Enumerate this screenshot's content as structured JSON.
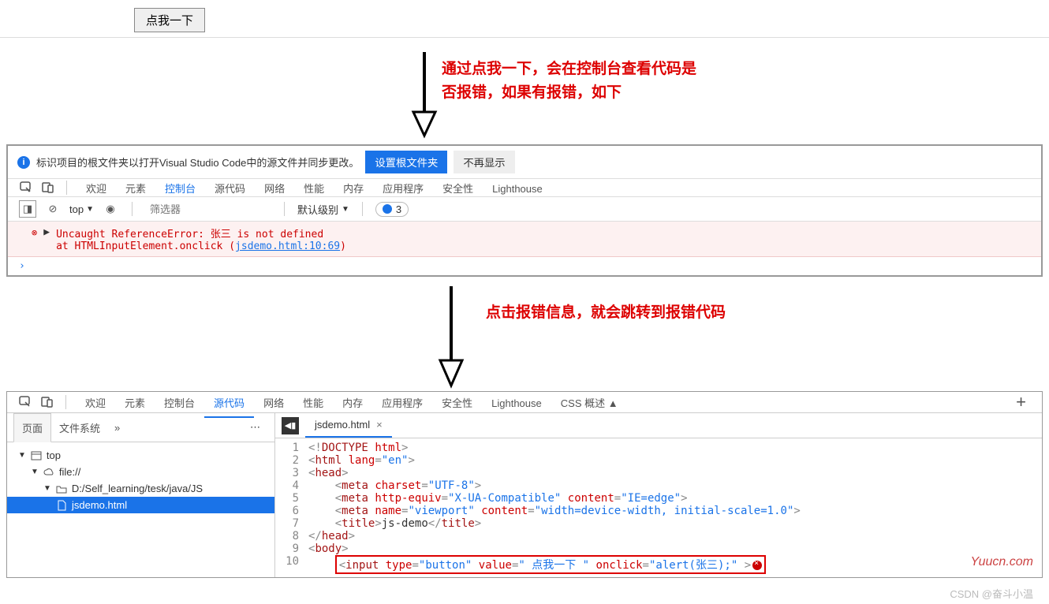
{
  "page": {
    "button_label": "点我一下"
  },
  "annotations": {
    "text1_line1": "通过点我一下，会在控制台查看代码是",
    "text1_line2": "否报错，如果有报错，如下",
    "text2": "点击报错信息，就会跳转到报错代码"
  },
  "notice": {
    "text": "标识项目的根文件夹以打开Visual Studio Code中的源文件并同步更改。",
    "btn_primary": "设置根文件夹",
    "btn_dismiss": "不再显示"
  },
  "tabs1": [
    "欢迎",
    "元素",
    "控制台",
    "源代码",
    "网络",
    "性能",
    "内存",
    "应用程序",
    "安全性",
    "Lighthouse"
  ],
  "tabs1_active": 2,
  "console_toolbar": {
    "context": "top",
    "filter_placeholder": "筛选器",
    "level": "默认级别",
    "issues": "3"
  },
  "console_error": {
    "line1_a": "Uncaught ReferenceError: ",
    "line1_b": "张三",
    "line1_c": " is not defined",
    "line2_a": "    at HTMLInputElement.onclick (",
    "line2_link": "jsdemo.html:10:69",
    "line2_b": ")"
  },
  "tabs2": [
    "欢迎",
    "元素",
    "控制台",
    "源代码",
    "网络",
    "性能",
    "内存",
    "应用程序",
    "安全性",
    "Lighthouse",
    "CSS 概述 ▲"
  ],
  "tabs2_active": 3,
  "sub_tabs": {
    "page": "页面",
    "fs": "文件系统",
    "chev": "»",
    "more": "⋯"
  },
  "tree": {
    "top": "top",
    "file": "file://",
    "dir": "D:/Self_learning/tesk/java/JS",
    "leaf": "jsdemo.html"
  },
  "open_file": "jsdemo.html",
  "code": [
    {
      "n": "1",
      "html": "<span class='punc'>&lt;!</span><span class='tag'>DOCTYPE</span> <span class='attr'>html</span><span class='punc'>&gt;</span>"
    },
    {
      "n": "2",
      "html": "<span class='punc'>&lt;</span><span class='tag'>html</span> <span class='attr'>lang</span><span class='punc'>=</span><span class='val'>\"en\"</span><span class='punc'>&gt;</span>"
    },
    {
      "n": "3",
      "html": "<span class='punc'>&lt;</span><span class='tag'>head</span><span class='punc'>&gt;</span>"
    },
    {
      "n": "4",
      "html": "    <span class='punc'>&lt;</span><span class='tag'>meta</span> <span class='attr'>charset</span><span class='punc'>=</span><span class='val'>\"UTF-8\"</span><span class='punc'>&gt;</span>"
    },
    {
      "n": "5",
      "html": "    <span class='punc'>&lt;</span><span class='tag'>meta</span> <span class='attr'>http-equiv</span><span class='punc'>=</span><span class='val'>\"X-UA-Compatible\"</span> <span class='attr'>content</span><span class='punc'>=</span><span class='val'>\"IE=edge\"</span><span class='punc'>&gt;</span>"
    },
    {
      "n": "6",
      "html": "    <span class='punc'>&lt;</span><span class='tag'>meta</span> <span class='attr'>name</span><span class='punc'>=</span><span class='val'>\"viewport\"</span> <span class='attr'>content</span><span class='punc'>=</span><span class='val'>\"width=device-width, initial-scale=1.0\"</span><span class='punc'>&gt;</span>"
    },
    {
      "n": "7",
      "html": "    <span class='punc'>&lt;</span><span class='tag'>title</span><span class='punc'>&gt;</span><span class='txt'>js-demo</span><span class='punc'>&lt;/</span><span class='tag'>title</span><span class='punc'>&gt;</span>"
    },
    {
      "n": "8",
      "html": "<span class='punc'>&lt;/</span><span class='tag'>head</span><span class='punc'>&gt;</span>"
    },
    {
      "n": "9",
      "html": "<span class='punc'>&lt;</span><span class='tag'>body</span><span class='punc'>&gt;</span>"
    },
    {
      "n": "10",
      "html": "    <span class='err-line'><span class='punc'>&lt;</span><span class='tag'>input</span> <span class='attr'>type</span><span class='punc'>=</span><span class='val'>\"button\"</span> <span class='attr'>value</span><span class='punc'>=</span><span class='val'>\" 点我一下 \"</span> <span class='attr'>onclick</span><span class='punc'>=</span><span class='val'>\"alert(张三);\"</span> <span class='punc'>&gt;</span><span class='err-dot'></span></span>"
    }
  ],
  "watermark": "Yuucn.com",
  "credit": "CSDN @奋斗小温"
}
